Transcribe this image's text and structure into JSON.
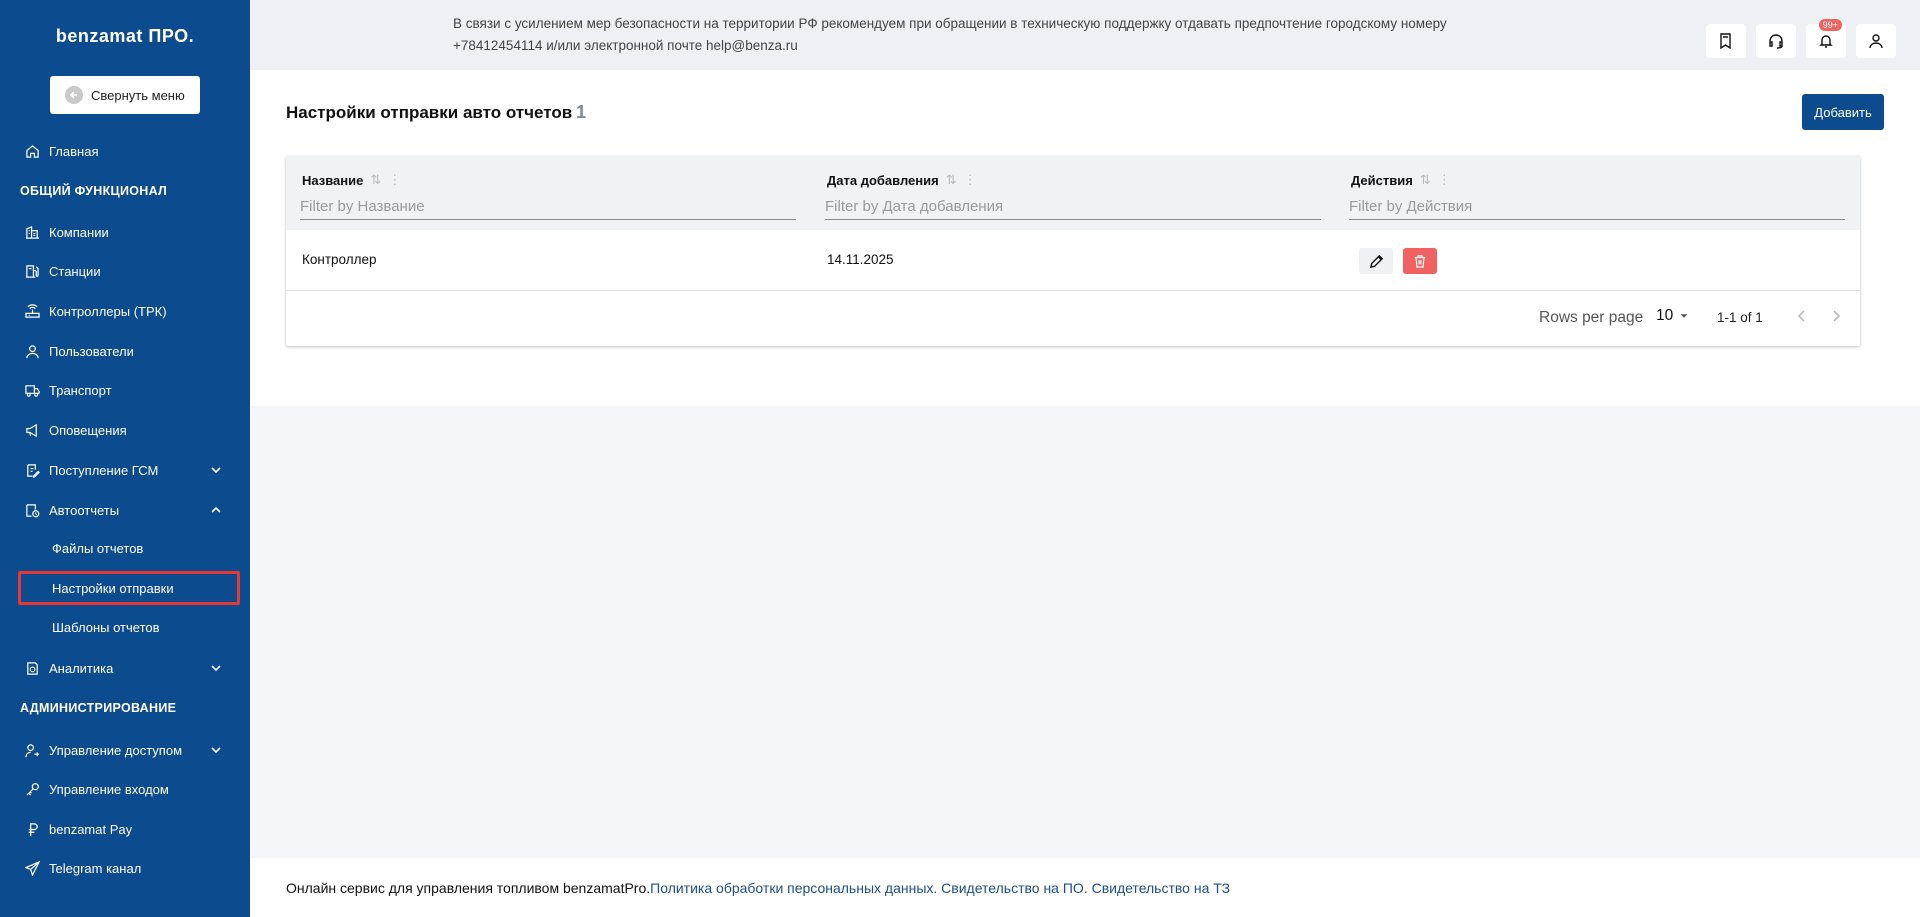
{
  "sidebar": {
    "logo": "benzamat ПРО.",
    "collapse_label": "Свернуть меню",
    "items": [
      {
        "label": "Главная"
      },
      {
        "label": "Компании"
      },
      {
        "label": "Станции"
      },
      {
        "label": "Контроллеры (ТРК)"
      },
      {
        "label": "Пользователи"
      },
      {
        "label": "Транспорт"
      },
      {
        "label": "Оповещения"
      },
      {
        "label": "Поступление ГСМ"
      },
      {
        "label": "Автоотчеты"
      },
      {
        "label": "Аналитика"
      },
      {
        "label": "Управление доступом"
      },
      {
        "label": "Управление входом"
      },
      {
        "label": "benzamat Pay"
      },
      {
        "label": "Telegram канал"
      }
    ],
    "sections": [
      "ОБЩИЙ ФУНКЦИОНАЛ",
      "АДМИНИСТРИРОВАНИЕ"
    ],
    "sub_items": [
      {
        "label": "Файлы отчетов"
      },
      {
        "label": "Настройки отправки",
        "active": true
      },
      {
        "label": "Шаблоны отчетов"
      }
    ]
  },
  "topbar": {
    "notice": "В связи с усилением мер безопасности на территории РФ рекомендуем при обращении в техническую поддержку отдавать предпочтение городскому номеру +78412454114 и/или электронной почте help@benza.ru",
    "notification_badge": "99+",
    "icons": [
      "book-icon",
      "headset-icon",
      "bell-icon",
      "user-icon"
    ]
  },
  "page": {
    "title": "Настройки отправки авто отчетов",
    "count": "1",
    "add_label": "Добавить"
  },
  "table": {
    "columns": [
      {
        "label": "Название",
        "filter_placeholder": "Filter by Название"
      },
      {
        "label": "Дата добавления",
        "filter_placeholder": "Filter by Дата добавления"
      },
      {
        "label": "Действия",
        "filter_placeholder": "Filter by Действия"
      }
    ],
    "rows": [
      {
        "name": "Контроллер",
        "date": "14.11.2025"
      }
    ],
    "pagination": {
      "rows_per_page_label": "Rows per page",
      "rows_per_page": "10",
      "range": "1-1 of 1"
    }
  },
  "footer": {
    "text": "Онлайн сервис для управления топливом benzamatPro.",
    "links": [
      "Политика обработки персональных данных.",
      "Свидетельство на ПО.",
      "Свидетельство на ТЗ"
    ]
  },
  "colors": {
    "sidebar": "#0c4b8e",
    "primary": "#0c4b8e",
    "delete": "#f06262",
    "highlight": "#e53935"
  }
}
